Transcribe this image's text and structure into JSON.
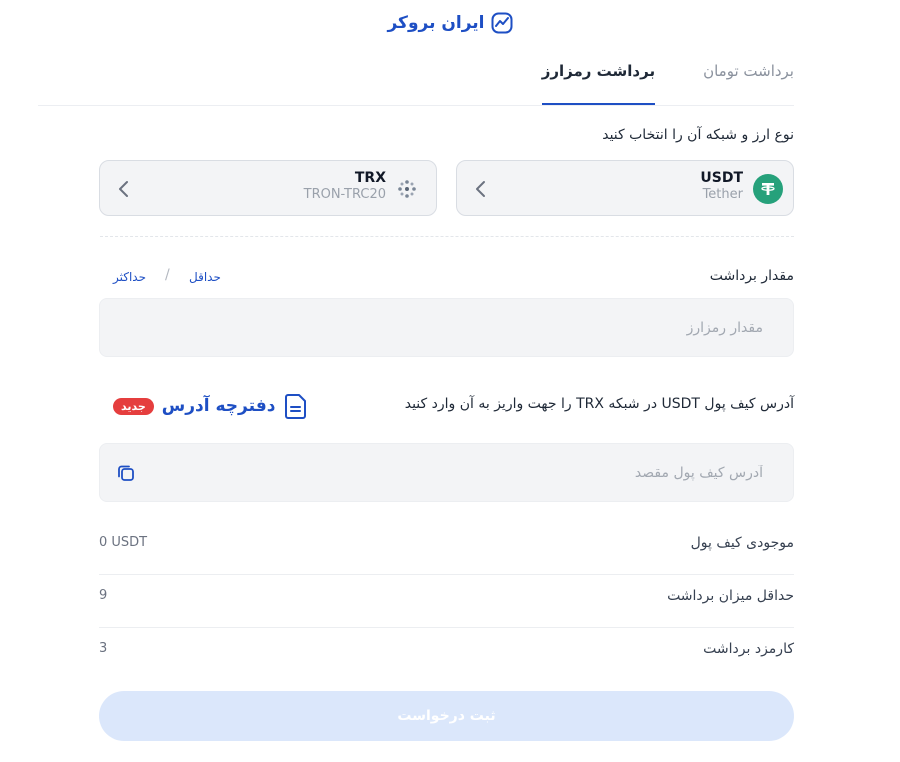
{
  "brand": {
    "name": "ایران بروکر",
    "color": "#1e4fc4"
  },
  "tabs": [
    {
      "label": "برداشت تومان",
      "active": false
    },
    {
      "label": "برداشت رمزارز",
      "active": true
    }
  ],
  "currency_section": {
    "title": "نوع ارز و شبکه آن را انتخاب کنید",
    "coin": {
      "symbol": "USDT",
      "name": "Tether",
      "icon": "tether-icon",
      "color": "#26a17b"
    },
    "network": {
      "symbol": "TRX",
      "name": "TRON-TRC20",
      "icon": "tron-network-icon"
    }
  },
  "amount": {
    "label": "مقدار برداشت",
    "min_link": "حداقل",
    "max_link": "حداکثر",
    "placeholder": "مقدار رمزارز"
  },
  "address": {
    "label": "آدرس کیف پول USDT در شبکه TRX را جهت واریز به آن وارد کنید",
    "addressbook_label": "دفترچه آدرس",
    "new_badge": "جدید",
    "placeholder": "آدرس کیف پول مقصد"
  },
  "info": [
    {
      "key": "موجودی کیف پول",
      "value": "0 USDT"
    },
    {
      "key": "حداقل میزان برداشت",
      "value": "9"
    },
    {
      "key": "کارمزد برداشت",
      "value": "3"
    }
  ],
  "submit_label": "ثبت درخواست",
  "colors": {
    "accent": "#1e4fc4",
    "badge": "#e53e3e",
    "submit_disabled": "#dbe7fb"
  }
}
